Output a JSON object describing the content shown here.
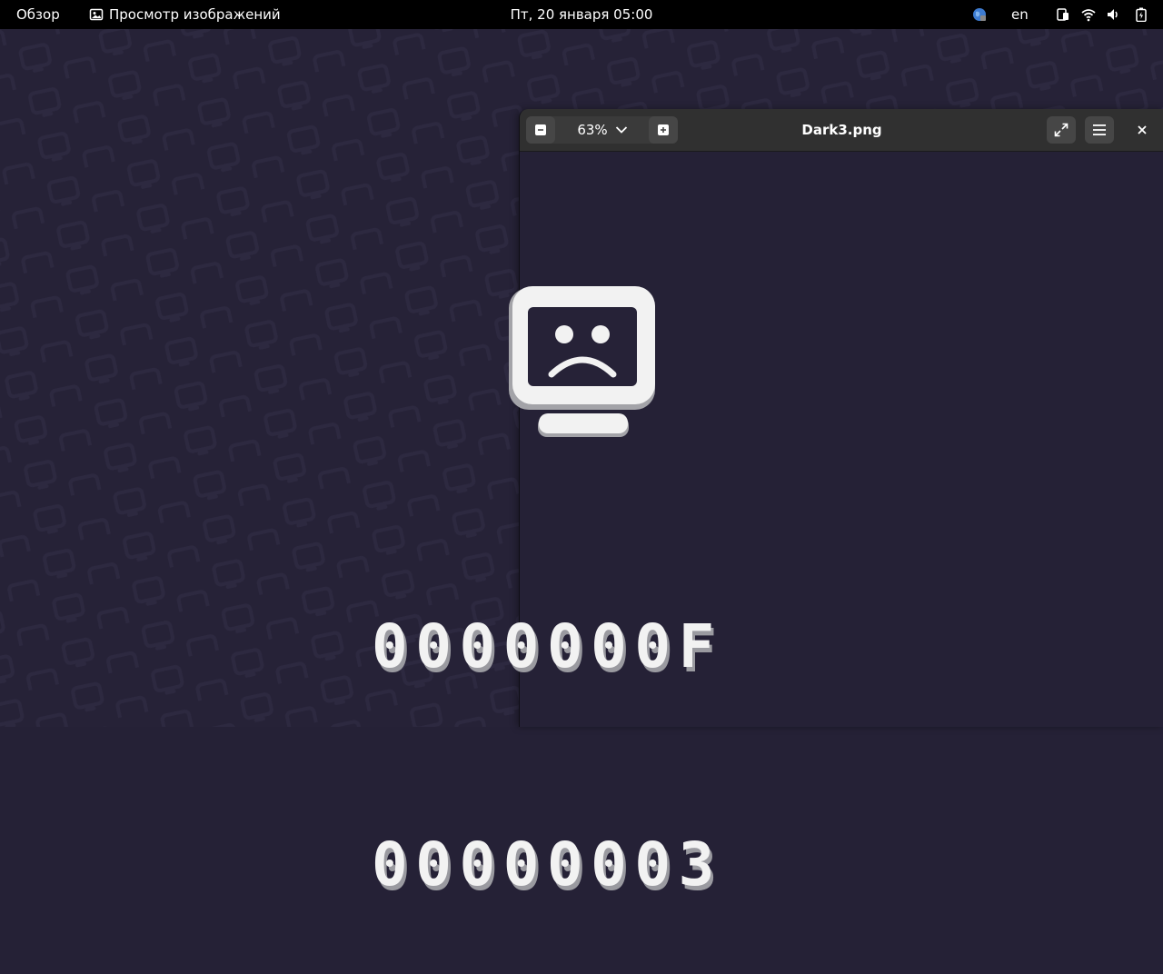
{
  "topbar": {
    "activities": "Обзор",
    "app_name": "Просмотр изображений",
    "clock": "Пт, 20 января  05:00",
    "language": "en",
    "tray_icons": [
      "network-globe-icon",
      "display-icon",
      "wifi-icon",
      "volume-icon",
      "battery-icon"
    ]
  },
  "viewer": {
    "title": "Dark3.png",
    "zoom": "63%",
    "buttons": {
      "zoom_out": "zoom-out-icon",
      "zoom_dropdown": "chevron-down-icon",
      "zoom_in": "zoom-in-icon",
      "fullscreen": "fullscreen-icon",
      "menu": "hamburger-menu-icon",
      "close": "close-icon"
    }
  },
  "image": {
    "error_code_line1": "0000000F",
    "error_code_line2": "00000003",
    "icon": "sad-computer-icon"
  },
  "colors": {
    "wallpaper": "#262237",
    "topbar": "#000000",
    "headerbar": "#303030",
    "art": "#f2f2f2"
  }
}
